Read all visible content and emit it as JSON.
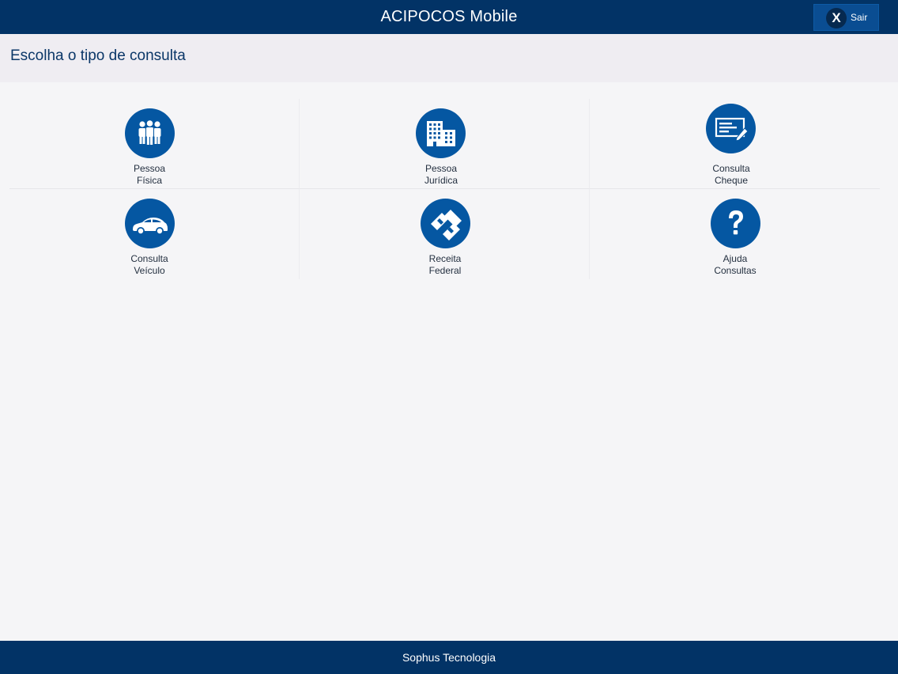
{
  "header": {
    "title": "ACIPOCOS Mobile",
    "exit_icon_text": "X",
    "exit_label": "Sair"
  },
  "subheader": {
    "title": "Escolha o tipo de consulta"
  },
  "tiles": [
    {
      "icon": "people-icon",
      "line1": "Pessoa",
      "line2": "Física"
    },
    {
      "icon": "buildings-icon",
      "line1": "Pessoa",
      "line2": "Jurídica"
    },
    {
      "icon": "check-document-icon",
      "line1": "Consulta",
      "line2": "Cheque"
    },
    {
      "icon": "car-icon",
      "line1": "Consulta",
      "line2": "Veículo"
    },
    {
      "icon": "receita-federal-icon",
      "line1": "Receita",
      "line2": "Federal"
    },
    {
      "icon": "question-mark-icon",
      "line1": "Ajuda",
      "line2": "Consultas"
    }
  ],
  "footer": {
    "text": "Sophus Tecnologia"
  },
  "colors": {
    "header_bg": "#023366",
    "icon_circle": "#0557a2",
    "page_bg": "#f5f5f7",
    "subheader_bg": "#efedf2"
  }
}
